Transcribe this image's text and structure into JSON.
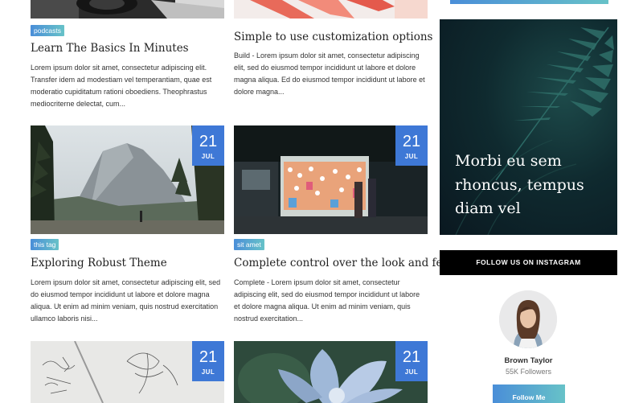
{
  "posts": [
    {
      "tag": "podcasts",
      "title": "Learn The Basics In Minutes",
      "excerpt": "Lorem ipsum dolor sit amet, consectetur adipiscing elit. Transfer idem ad modestiam vel temperantiam, quae est moderatio cupiditatum rationi oboediens. Theophrastus mediocriterne delectat, cum..."
    },
    {
      "title": "Simple to use customization options",
      "excerpt": "Build - Lorem ipsum dolor sit amet, consectetur adipiscing elit, sed do eiusmod tempor incididunt ut labore et dolore magna aliqua. Ed do eiusmod tempor incididunt ut labore et dolore magna..."
    },
    {
      "day": "21",
      "month": "JUL",
      "tag": "this tag",
      "title": "Exploring Robust Theme",
      "excerpt": "Lorem ipsum dolor sit amet, consectetur adipiscing elit, sed do eiusmod tempor incididunt ut labore et dolore magna aliqua. Ut enim ad minim veniam, quis nostrud exercitation ullamco laboris nisi..."
    },
    {
      "day": "21",
      "month": "JUL",
      "tag": "sit amet",
      "title": "Complete control over the look and feel",
      "excerpt": "Complete - Lorem ipsum dolor sit amet, consectetur adipiscing elit, sed do eiusmod tempor incididunt ut labore et dolore magna aliqua. Ut enim ad minim veniam, quis nostrud exercitation..."
    },
    {
      "day": "21",
      "month": "JUL"
    },
    {
      "day": "21",
      "month": "JUL"
    }
  ],
  "sidebar": {
    "promo_text": "Morbi eu sem rhoncus, tempus diam vel",
    "instagram_button": "FOLLOW US ON INSTAGRAM",
    "profile": {
      "name": "Brown Taylor",
      "followers": "55K Followers",
      "follow_button": "Follow Me"
    }
  },
  "colors": {
    "accent_blue": "#3e78d6",
    "tag_gradient_start": "#4a8ed8",
    "tag_gradient_end": "#67c2c8"
  }
}
